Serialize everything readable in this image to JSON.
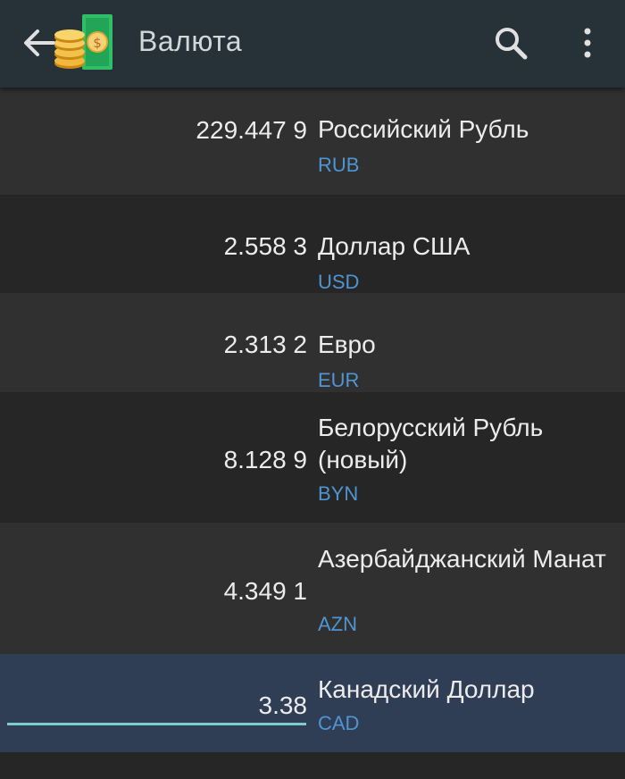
{
  "appbar": {
    "title": "Валюта",
    "back_icon": "arrow-left-icon",
    "logo_icon": "coins-money-icon",
    "search_icon": "search-icon",
    "more_icon": "more-vert-icon"
  },
  "currencies": [
    {
      "amount": "229.447 9",
      "name": "Российский Рубль",
      "code": "RUB"
    },
    {
      "amount": "2.558 3",
      "name": "Доллар США",
      "code": "USD"
    },
    {
      "amount": "2.313 2",
      "name": "Евро",
      "code": "EUR"
    },
    {
      "amount": "8.128 9",
      "name": "Белорусский Рубль (новый)",
      "code": "BYN"
    },
    {
      "amount": "4.349 1",
      "name": "Азербайджанский Манат",
      "code": "AZN"
    },
    {
      "amount": "3.38",
      "name": "Канадский Доллар",
      "code": "CAD",
      "selected": true
    }
  ],
  "colors": {
    "appbar": "#263238",
    "code_text": "#4f95d1",
    "selected_row": "#2f3d55",
    "input_underline": "#7ecbc7"
  }
}
